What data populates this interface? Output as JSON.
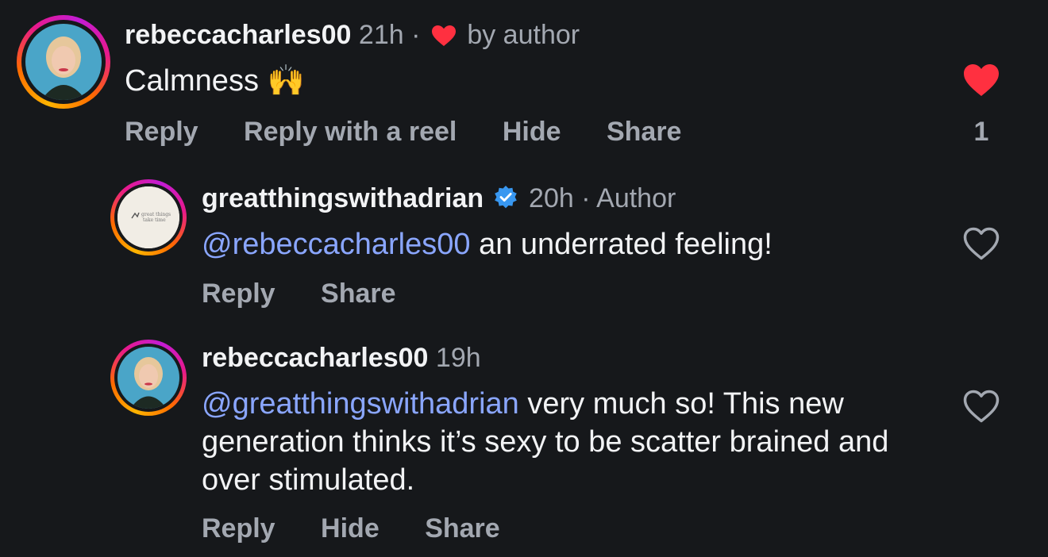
{
  "comments": [
    {
      "username": "rebeccacharles00",
      "time": "21h",
      "separator": "·",
      "liked_by_label": "by author",
      "text": "Calmness",
      "emoji": "🙌",
      "actions": [
        "Reply",
        "Reply with a reel",
        "Hide",
        "Share"
      ],
      "like_count": "1",
      "liked": true
    },
    {
      "username": "greatthingswithadrian",
      "time": "20h",
      "separator": "·",
      "author_tag": "Author",
      "avatar_text": "great things take time",
      "mention": "@rebeccacharles00",
      "text": " an underrated feeling!",
      "actions": [
        "Reply",
        "Share"
      ],
      "liked": false
    },
    {
      "username": "rebeccacharles00",
      "time": "19h",
      "mention": "@greatthingswithadrian",
      "text": " very much so! This new generation thinks it’s sexy to be scatter brained and over stimulated.",
      "actions": [
        "Reply",
        "Hide",
        "Share"
      ],
      "liked": false
    }
  ],
  "colors": {
    "background": "#16181b",
    "mention": "#8aa6ff",
    "like_active": "#ff3040",
    "verified": "#3897f0"
  },
  "icons": {
    "like": "heart-icon",
    "verified": "verified-badge-icon"
  }
}
